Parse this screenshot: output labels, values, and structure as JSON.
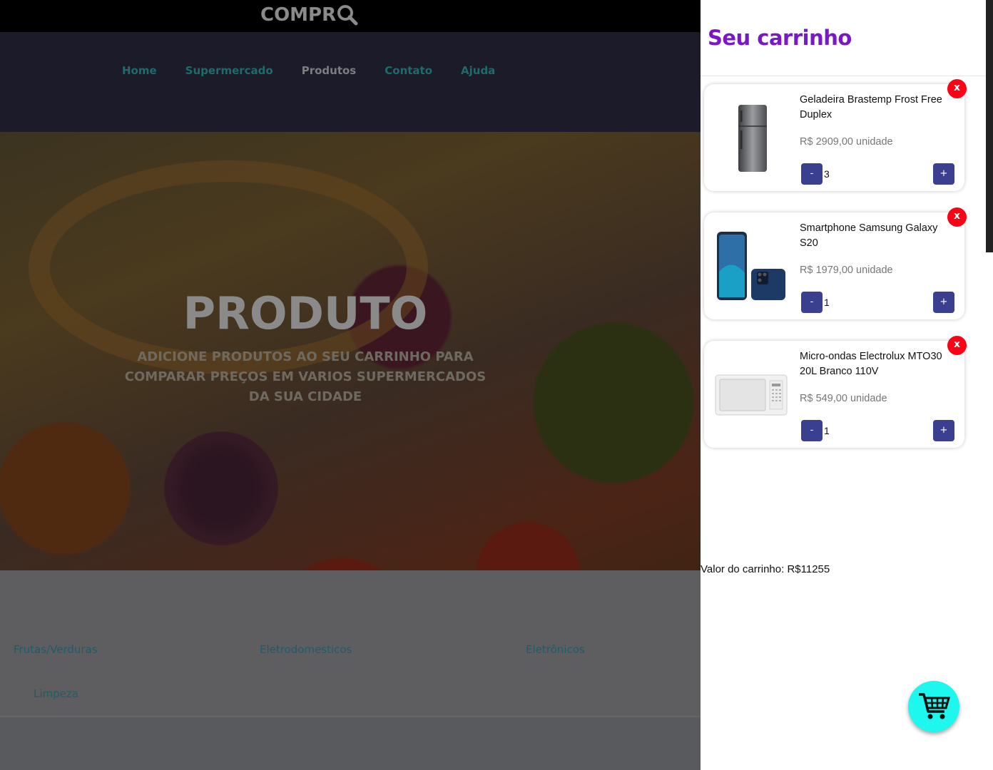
{
  "brand": {
    "logo_text": "COMPR"
  },
  "nav": {
    "items": [
      "Home",
      "Supermercado",
      "Produtos",
      "Contato",
      "Ajuda"
    ],
    "active": "Produtos"
  },
  "hero": {
    "title": "PRODUTO",
    "subtitle": "ADICIONE PRODUTOS AO SEU CARRINHO PARA COMPARAR PREÇOS EM VARIOS SUPERMERCADOS DA SUA CIDADE"
  },
  "categories": [
    "Frutas/Verduras",
    "Eletrodomesticos",
    "Eletrônicos",
    "Limpeza"
  ],
  "cart": {
    "title": "Seu carrinho",
    "items": [
      {
        "name": "Geladeira Brastemp Frost Free Duplex",
        "price": "R$ 2909,00 unidade",
        "qty": "3",
        "minus": "-",
        "plus": "+",
        "remove": "x",
        "image": "refrigerator-image"
      },
      {
        "name": "Smartphone Samsung Galaxy S20",
        "price": "R$ 1979,00 unidade",
        "qty": "1",
        "minus": "-",
        "plus": "+",
        "remove": "x",
        "image": "smartphone-image"
      },
      {
        "name": "Micro-ondas Electrolux MTO30 20L Branco 110V",
        "price": "R$ 549,00 unidade",
        "qty": "1",
        "minus": "-",
        "plus": "+",
        "remove": "x",
        "image": "microwave-image"
      }
    ],
    "total": "Valor do carrinho: R$11255"
  },
  "colors": {
    "accent_title": "#7a17c9",
    "qty_buttons": "#3a3f8f",
    "remove_button": "#ff0016",
    "cart_fab": "#1ef7ee",
    "nav_link": "#1f6a6c"
  },
  "icons": {
    "logo": "magnifier-icon",
    "fab": "shopping-cart-icon"
  }
}
